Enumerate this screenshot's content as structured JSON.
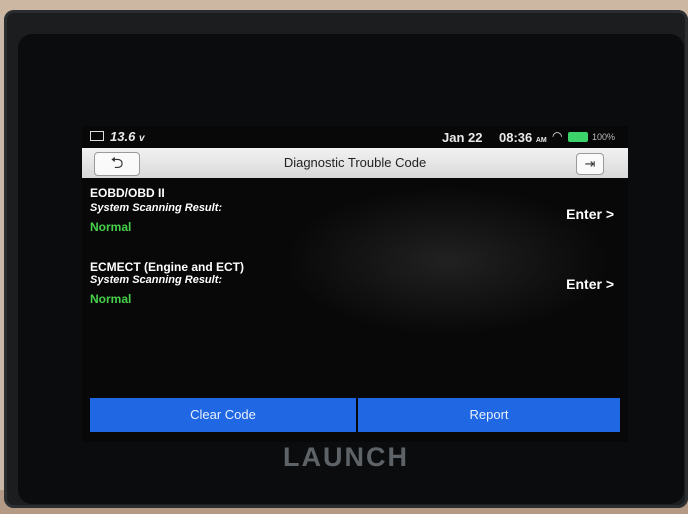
{
  "device": {
    "brand": "LAUNCH"
  },
  "status_bar": {
    "voltage": "13.6",
    "voltage_unit": "v",
    "date": "Jan 22",
    "time": "08:36",
    "time_suffix": "AM",
    "battery_percent": "100%"
  },
  "header": {
    "title": "Diagnostic Trouble Code"
  },
  "systems": [
    {
      "name": "EOBD/OBD II",
      "label": "System Scanning Result:",
      "result": "Normal",
      "action": "Enter >"
    },
    {
      "name": "ECMECT (Engine and ECT)",
      "label": "System Scanning Result:",
      "result": "Normal",
      "action": "Enter >"
    }
  ],
  "footer": {
    "clear_label": "Clear Code",
    "report_label": "Report"
  },
  "colors": {
    "accent_blue": "#1f67e3",
    "result_green": "#45d24a"
  }
}
